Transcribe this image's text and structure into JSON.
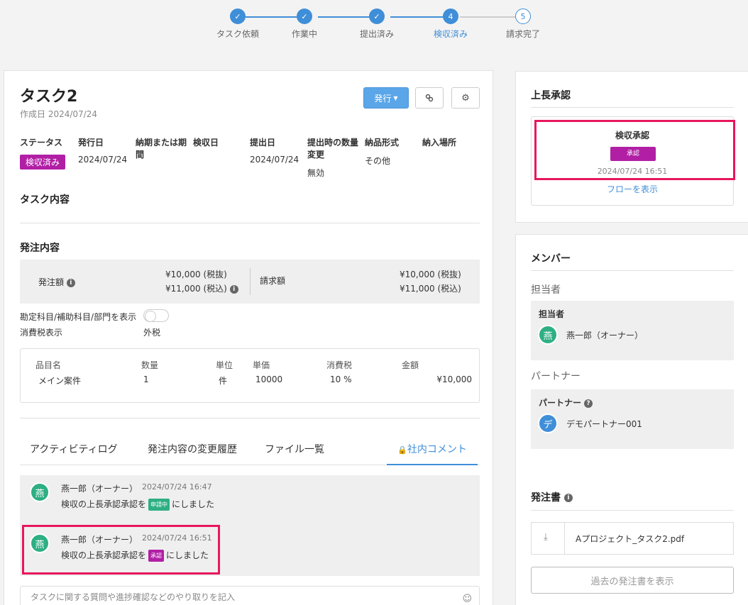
{
  "stepper": {
    "steps": [
      {
        "label": "タスク依頼",
        "state": "done",
        "icon": "check-icon",
        "num": "1"
      },
      {
        "label": "作業中",
        "state": "done",
        "icon": "check-icon",
        "num": "2"
      },
      {
        "label": "提出済み",
        "state": "done",
        "icon": "check-icon",
        "num": "3"
      },
      {
        "label": "検収済み",
        "state": "current",
        "num": "4"
      },
      {
        "label": "請求完了",
        "state": "todo",
        "num": "5"
      }
    ]
  },
  "task": {
    "title": "タスク2",
    "created": "作成日 2024/07/24",
    "issue_button": "発行",
    "link_icon": "link-icon",
    "gear_icon": "gear-icon",
    "meta": {
      "status_h": "ステータス",
      "status_v": "検収済み",
      "issue_date_h": "発行日",
      "issue_date_v": "2024/07/24",
      "deadline_h": "納期または期間",
      "inspect_h": "検収日",
      "submit_h": "提出日",
      "submit_v": "2024/07/24",
      "qty_change_h": "提出時の数量変更",
      "qty_change_v": "無効",
      "delivery_h": "納品形式",
      "delivery_v": "その他",
      "place_h": "納入場所"
    },
    "content_h": "タスク内容",
    "order_h": "発注内容",
    "order": {
      "amount_label": "発注額",
      "amount_ex": "¥10,000 (税抜)",
      "amount_in": "¥11,000 (税込)",
      "invoice_label": "請求額",
      "invoice_ex": "¥10,000 (税抜)",
      "invoice_in": "¥11,000 (税込)"
    },
    "toggle_label": "勘定科目/補助科目/部門を表示",
    "tax_label": "消費税表示",
    "tax_value": "外税",
    "items": {
      "headers": [
        "品目名",
        "数量",
        "単位",
        "単価",
        "消費税",
        "金額"
      ],
      "row": [
        "メイン案件",
        "1",
        "件",
        "10000",
        "10 %",
        "¥10,000"
      ]
    },
    "tabs": [
      "アクティビティログ",
      "発注内容の変更履歴",
      "ファイル一覧",
      "社内コメント"
    ],
    "comments": [
      {
        "avatar": "燕",
        "name": "燕一郎（オーナー）",
        "time": "2024/07/24 16:47",
        "pre": "検収の上長承認承認を",
        "badge": "申請中",
        "post": "にしました"
      },
      {
        "avatar": "燕",
        "name": "燕一郎（オーナー）",
        "time": "2024/07/24 16:51",
        "pre": "検収の上長承認承認を",
        "badge": "承認",
        "post": "にしました"
      }
    ],
    "input_placeholder": "タスクに関する質問や進捗確認などのやり取りを記入"
  },
  "approval": {
    "heading": "上長承認",
    "title": "検収承認",
    "badge": "承認",
    "time": "2024/07/24 16:51",
    "link": "フローを表示"
  },
  "members": {
    "heading": "メンバー",
    "assignee_section": "担当者",
    "assignee_box_h": "担当者",
    "assignee_avatar": "燕",
    "assignee_name": "燕一郎（オーナー）",
    "partner_section": "パートナー",
    "partner_box_h": "パートナー",
    "partner_avatar": "デ",
    "partner_name": "デモパートナー001",
    "po_heading": "発注書",
    "file_name": "Aプロジェクト_タスク2.pdf",
    "past_button": "過去の発注書を表示"
  },
  "colors": {
    "accent": "#3f8ed8",
    "status_purple": "#b11fa5",
    "highlight": "#e8175d",
    "avatar_green": "#2eaf83"
  }
}
